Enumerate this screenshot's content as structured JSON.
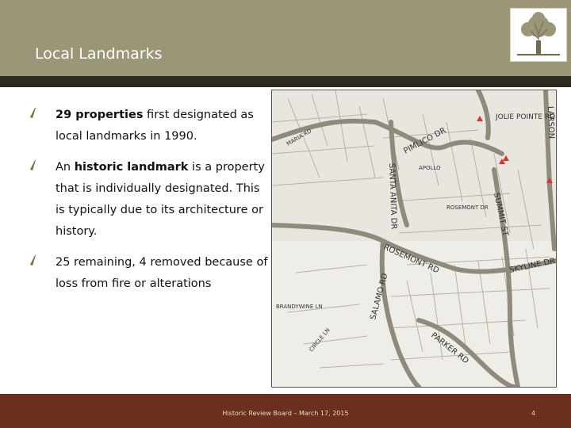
{
  "slide": {
    "title": "Local Landmarks",
    "bullets": [
      {
        "bold": "29 properties",
        "rest": " first designated as local landmarks in 1990."
      },
      {
        "pre": "An ",
        "bold": "historic landmark",
        "rest": " is a property that is individually designated. This is typically due to its architecture or history."
      },
      {
        "text": "25 remaining, 4 removed because of loss from fire or alterations"
      }
    ],
    "footer": "Historic Review Board – March 17, 2015",
    "page_number": "4"
  },
  "map": {
    "street_labels": [
      "JOLIE POINTE RD",
      "PIMLICO DR",
      "SANTA ANITA DR",
      "ROSEMONT RD",
      "SALAMO RD",
      "PARKER RD",
      "SUMMIT ST",
      "SKYLINE DR",
      "LARSON",
      "ROSEMONT DR",
      "APOLLO",
      "MARIA RD",
      "BRANDYWINE LN",
      "CIRCLE LN"
    ]
  },
  "colors": {
    "header": "#9c9678",
    "header_line": "#2d2a1f",
    "footer": "#6b2f1e",
    "bullet": "#7a6b3d",
    "landmark_marker": "#d23a2b"
  }
}
